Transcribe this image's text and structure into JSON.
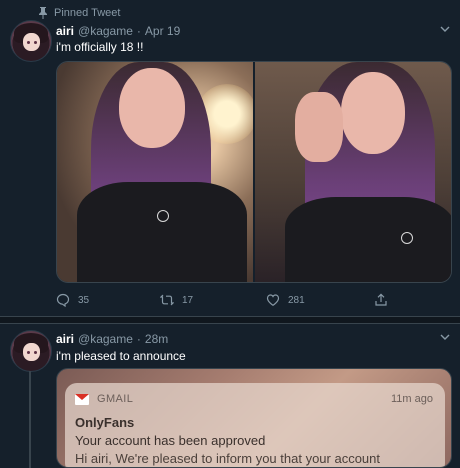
{
  "tweet1": {
    "pinned_label": "Pinned Tweet",
    "name": "airi",
    "handle": "@kagame",
    "separator": "·",
    "date": "Apr 19",
    "text": "i'm officially 18 !!",
    "actions": {
      "replies": "35",
      "retweets": "17",
      "likes": "281"
    }
  },
  "tweet2": {
    "name": "airi",
    "handle": "@kagame",
    "separator": "·",
    "date": "28m",
    "text": "i'm pleased to announce",
    "notification": {
      "app": "GMAIL",
      "time": "11m ago",
      "sender": "OnlyFans",
      "subject": "Your account has been approved",
      "body": "Hi airi, We're pleased to inform you that your account"
    }
  },
  "colors": {
    "background": "#15202b",
    "secondary_text": "#8899a6",
    "divider": "#38444d"
  },
  "icons": [
    "pin-icon",
    "reply-icon",
    "retweet-icon",
    "like-icon",
    "share-icon",
    "chevron-down-icon",
    "gmail-icon"
  ]
}
